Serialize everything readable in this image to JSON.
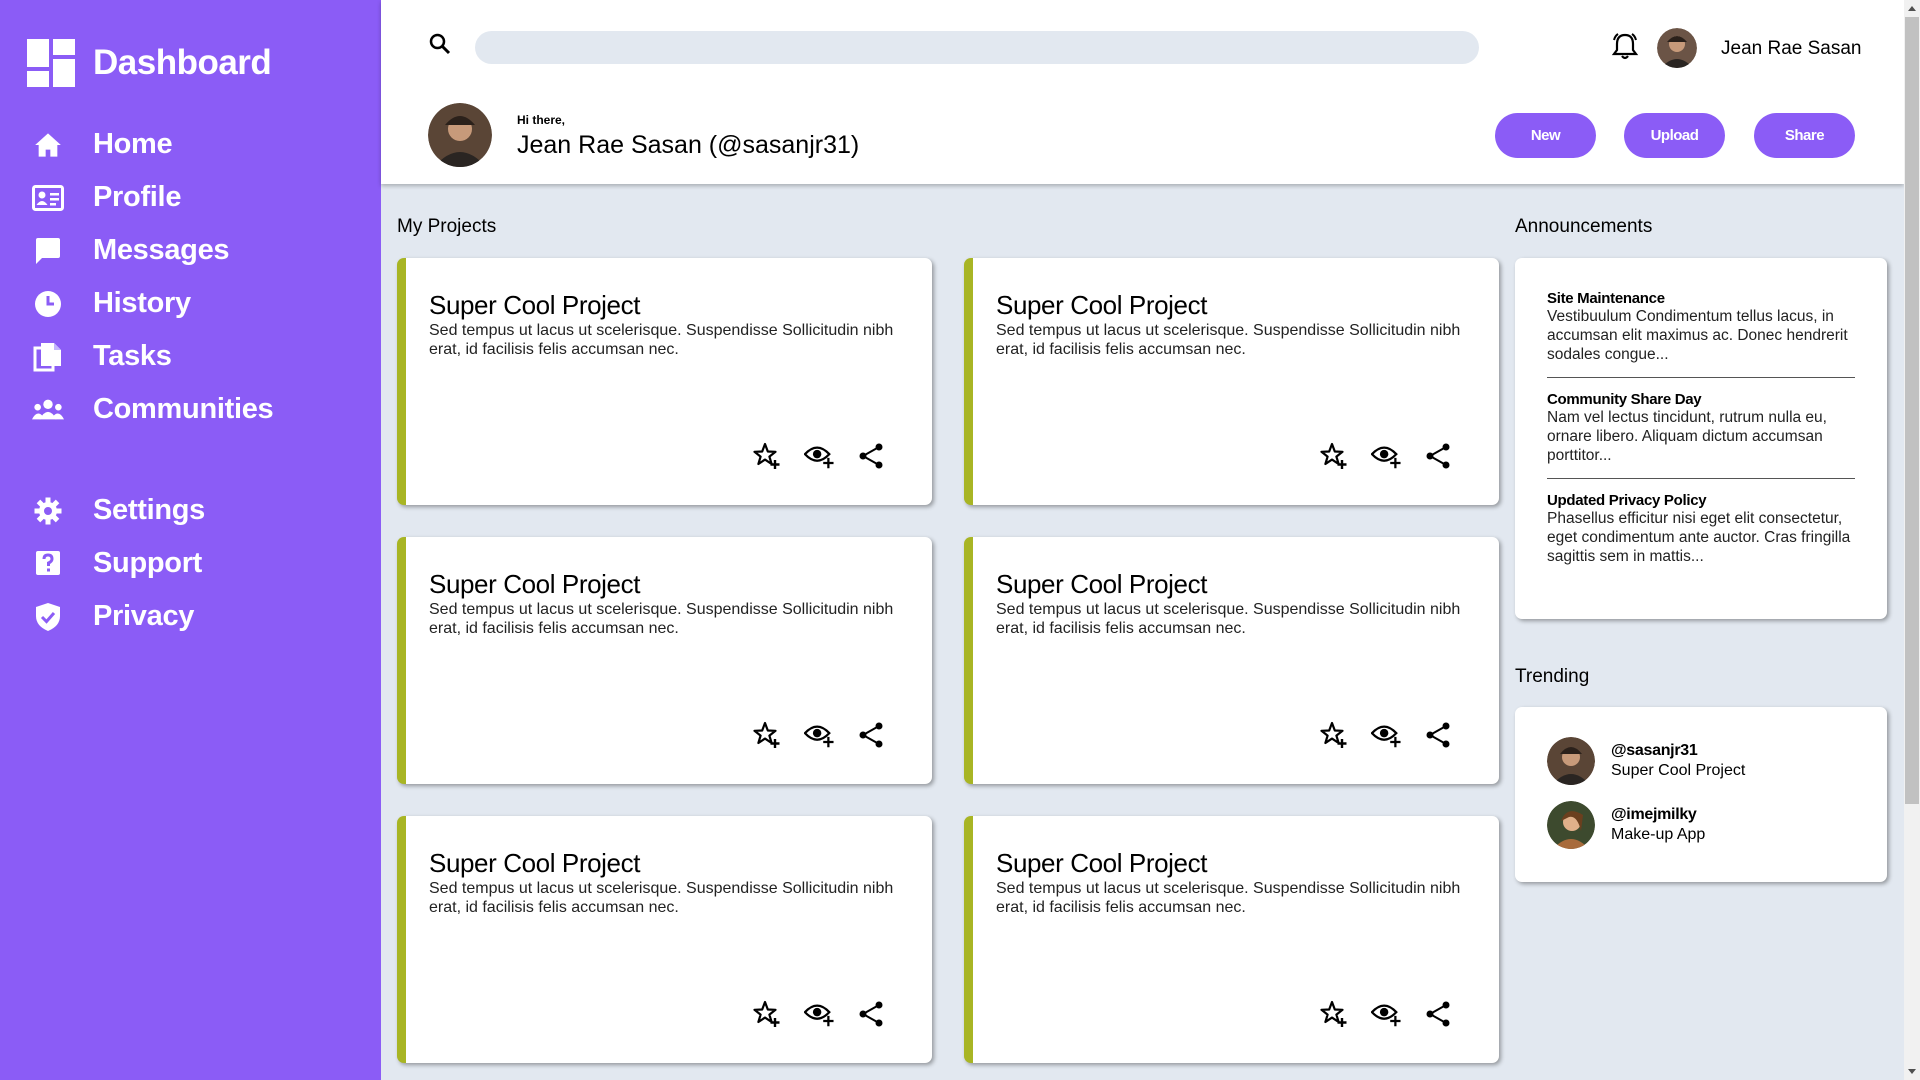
{
  "brand": {
    "title": "Dashboard",
    "accent_color": "#8b5cf6"
  },
  "nav": {
    "items": [
      {
        "label": "Home",
        "icon": "home-icon"
      },
      {
        "label": "Profile",
        "icon": "id-card-icon"
      },
      {
        "label": "Messages",
        "icon": "chat-bubble-icon"
      },
      {
        "label": "History",
        "icon": "clock-icon"
      },
      {
        "label": "Tasks",
        "icon": "documents-icon"
      },
      {
        "label": "Communities",
        "icon": "group-icon"
      },
      {
        "label": "Settings",
        "icon": "gear-icon"
      },
      {
        "label": "Support",
        "icon": "question-icon"
      },
      {
        "label": "Privacy",
        "icon": "shield-icon"
      }
    ]
  },
  "header": {
    "search_placeholder": "",
    "user_name": "Jean Rae Sasan",
    "greeting": "Hi there,",
    "full_handle": "Jean Rae Sasan (@sasanjr31)",
    "buttons": {
      "new": "New",
      "upload": "Upload",
      "share": "Share"
    }
  },
  "projects": {
    "title": "My Projects",
    "card_accent": "#a8b524",
    "items": [
      {
        "title": "Super Cool Project",
        "desc": "Sed tempus ut lacus ut scelerisque. Suspendisse Sollicitudin nibh erat, id facilisis felis accumsan nec."
      },
      {
        "title": "Super Cool Project",
        "desc": "Sed tempus ut lacus ut scelerisque. Suspendisse Sollicitudin nibh erat, id facilisis felis accumsan nec."
      },
      {
        "title": "Super Cool Project",
        "desc": "Sed tempus ut lacus ut scelerisque. Suspendisse Sollicitudin nibh erat, id facilisis felis accumsan nec."
      },
      {
        "title": "Super Cool Project",
        "desc": "Sed tempus ut lacus ut scelerisque. Suspendisse Sollicitudin nibh erat, id facilisis felis accumsan nec."
      },
      {
        "title": "Super Cool Project",
        "desc": "Sed tempus ut lacus ut scelerisque. Suspendisse Sollicitudin nibh erat, id facilisis felis accumsan nec."
      },
      {
        "title": "Super Cool Project",
        "desc": "Sed tempus ut lacus ut scelerisque. Suspendisse Sollicitudin nibh erat, id facilisis felis accumsan nec."
      }
    ]
  },
  "announcements": {
    "title": "Announcements",
    "items": [
      {
        "title": "Site Maintenance",
        "text": "Vestibuulum Condimentum tellus lacus, in accumsan elit maximus ac. Donec hendrerit sodales congue..."
      },
      {
        "title": "Community Share Day",
        "text": "Nam vel lectus tincidunt, rutrum nulla eu, ornare libero. Aliquam dictum accumsan porttitor..."
      },
      {
        "title": "Updated Privacy Policy",
        "text": "Phasellus efficitur nisi eget elit consectetur, eget condimentum ante auctor. Cras fringilla sagittis sem in mattis..."
      }
    ]
  },
  "trending": {
    "title": "Trending",
    "items": [
      {
        "handle": "@sasanjr31",
        "project": "Super Cool Project"
      },
      {
        "handle": "@imejmilky",
        "project": "Make-up App"
      }
    ]
  }
}
